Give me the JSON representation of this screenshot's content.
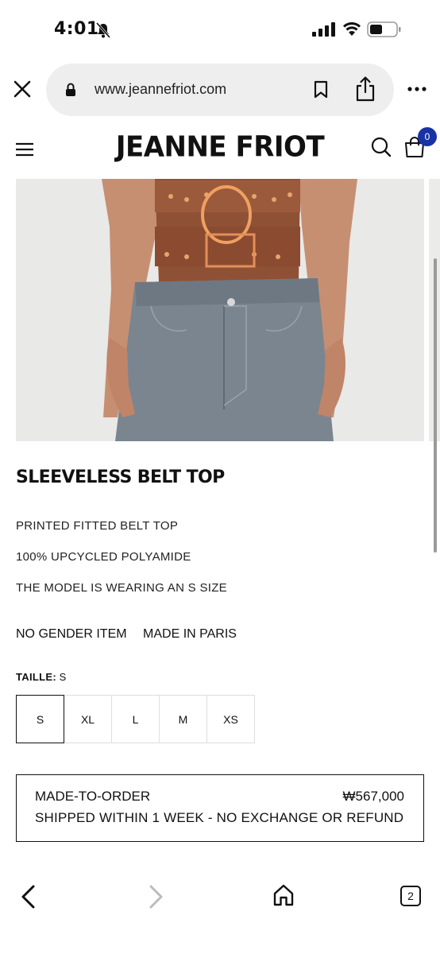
{
  "status_bar": {
    "time": "4:01"
  },
  "browser": {
    "url": "www.jeannefriot.com",
    "open_tabs": "2"
  },
  "site": {
    "logo": "JEANNE FRIOT",
    "cart_count": "0"
  },
  "product": {
    "title": "SLEEVELESS BELT TOP",
    "description": [
      "PRINTED FITTED BELT TOP",
      "100% UPCYCLED POLYAMIDE",
      "THE MODEL IS WEARING AN S SIZE"
    ],
    "tags": [
      "NO GENDER ITEM",
      "MADE IN PARIS"
    ],
    "size_label": "TAILLE:",
    "selected_size": "S",
    "sizes": [
      "S",
      "XL",
      "L",
      "M",
      "XS"
    ],
    "order": {
      "title": "MADE-TO-ORDER",
      "price": "₩567,000",
      "note": "SHIPPED WITHIN 1 WEEK - NO EXCHANGE OR REFUND"
    }
  },
  "colors": {
    "accent_badge": "#1733a6",
    "url_bar_bg": "#eeeeee",
    "image_bg": "#e9e9e7"
  }
}
